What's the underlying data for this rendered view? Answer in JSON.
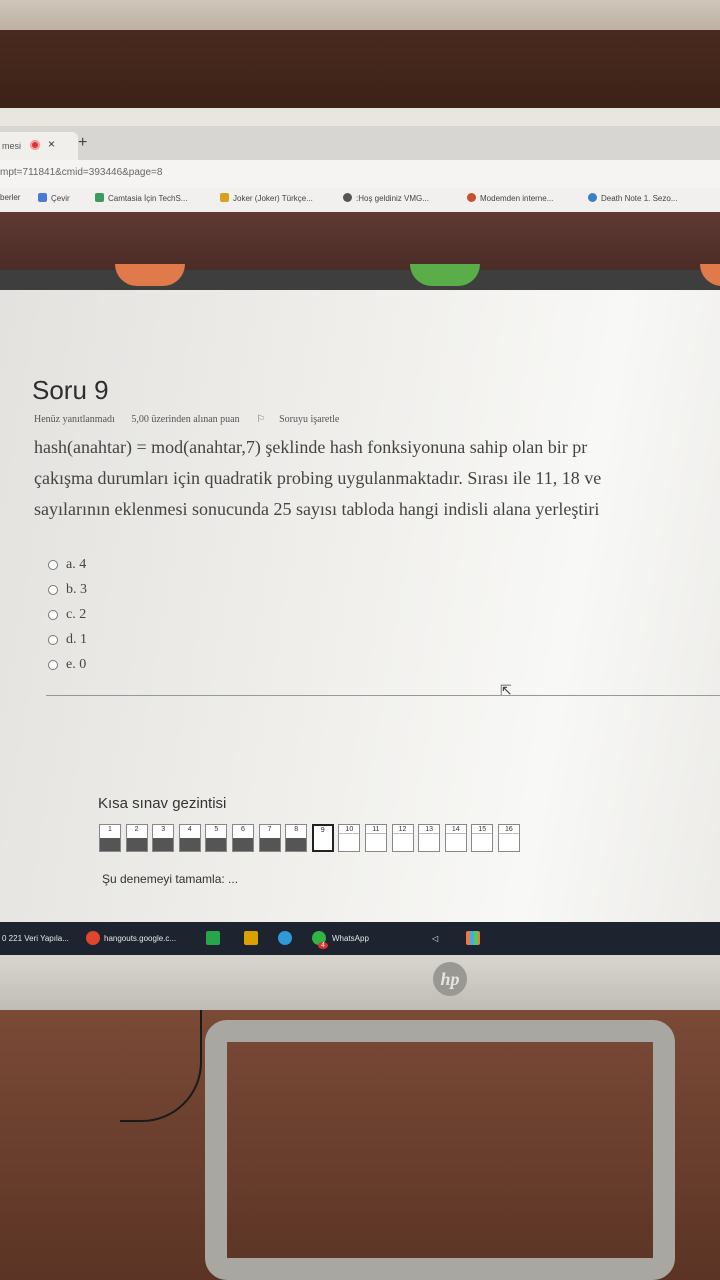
{
  "browser": {
    "tab_title": "mesi",
    "tab_close": "×",
    "new_tab": "+",
    "url": "mpt=711841&cmid=393446&page=8",
    "bookmarks": [
      {
        "label": "berler",
        "color": "#bbbbbb"
      },
      {
        "label": "Çevir",
        "color": "#4a7bd4"
      },
      {
        "label": "Camtasia İçin TechS...",
        "color": "#3a9b5a"
      },
      {
        "label": "Joker (Joker) Türkçe...",
        "color": "#d6a21e"
      },
      {
        "label": ":Hoş geldiniz VMG...",
        "color": "#555555"
      },
      {
        "label": "Modemden interne...",
        "color": "#c9502d"
      },
      {
        "label": "Death Note 1. Sezo...",
        "color": "#3c7fc4"
      }
    ]
  },
  "question": {
    "title": "Soru 9",
    "status": "Henüz yanıtlanmadı",
    "points": "5,00 üzerinden alınan puan",
    "flag_label": "Soruyu işaretle",
    "text_lines": [
      "hash(anahtar) = mod(anahtar,7) şeklinde hash fonksiyonuna sahip olan bir pr",
      "çakışma durumları için quadratik probing uygulanmaktadır. Sırası ile 11, 18 ve",
      "sayılarının eklenmesi sonucunda 25 sayısı tabloda hangi indisli alana yerleştiri"
    ],
    "answers": [
      "a. 4",
      "b. 3",
      "c. 2",
      "d. 1",
      "e. 0"
    ]
  },
  "quiz_nav": {
    "title": "Kısa sınav gezintisi",
    "buttons": [
      {
        "label": "1",
        "state": "answered"
      },
      {
        "label": "2",
        "state": "answered"
      },
      {
        "label": "3",
        "state": "answered"
      },
      {
        "label": "4",
        "state": "answered"
      },
      {
        "label": "5",
        "state": "answered"
      },
      {
        "label": "6",
        "state": "answered"
      },
      {
        "label": "7",
        "state": "answered"
      },
      {
        "label": "8",
        "state": "answered"
      },
      {
        "label": "9",
        "state": "current"
      },
      {
        "label": "10",
        "state": "unanswered"
      },
      {
        "label": "11",
        "state": "unanswered"
      },
      {
        "label": "12",
        "state": "unanswered"
      },
      {
        "label": "13",
        "state": "unanswered"
      },
      {
        "label": "14",
        "state": "unanswered"
      },
      {
        "label": "15",
        "state": "unanswered"
      },
      {
        "label": "16",
        "state": "unanswered"
      }
    ],
    "finish_link": "Şu denemeyi tamamla: ..."
  },
  "taskbar": {
    "items": [
      {
        "label": "0 221 Veri Yapıla...",
        "icon": "document-icon",
        "color": "#2b5797"
      },
      {
        "label": "hangouts.google.c...",
        "icon": "chrome-icon",
        "color": "#e0462b"
      },
      {
        "label": "",
        "icon": "camtasia-icon",
        "color": "#27a54a"
      },
      {
        "label": "",
        "icon": "filezilla-icon",
        "color": "#d9a200"
      },
      {
        "label": "",
        "icon": "telegram-icon",
        "color": "#2e9bd6"
      },
      {
        "label": "WhatsApp",
        "icon": "whatsapp-icon",
        "color": "#30b545"
      }
    ],
    "whatsapp_badge": "4"
  },
  "monitor": {
    "brand": "hp"
  }
}
